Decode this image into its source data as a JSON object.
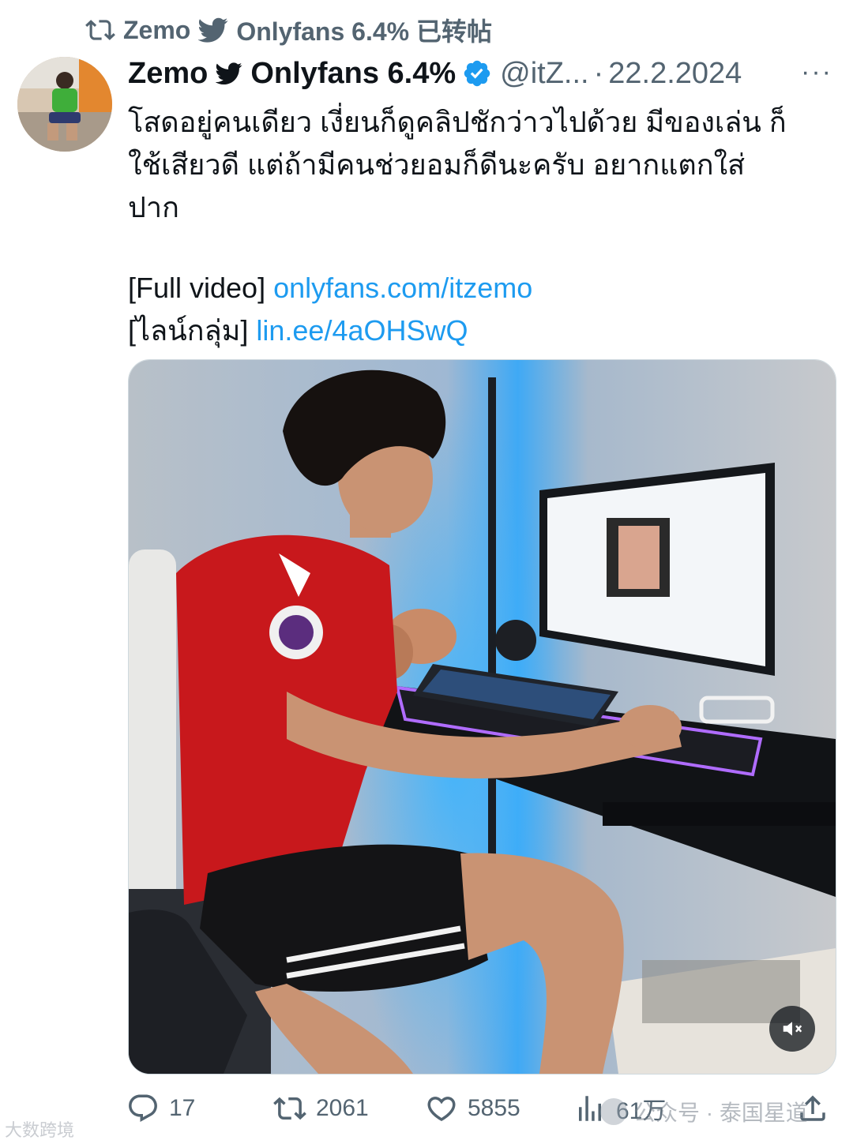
{
  "repost_banner": {
    "text": "Zemo",
    "suffix": "Onlyfans 6.4% 已转帖"
  },
  "author": {
    "name_a": "Zemo",
    "name_b": "Onlyfans 6.4%",
    "handle": "@itZ...",
    "date": "22.2.2024",
    "more": "···"
  },
  "tweet": {
    "line1": "โสดอยู่คนเดียว เงี่ยนก็ดูคลิปชักว่าวไปด้วย มีของเล่น ก็",
    "line2": "ใช้เสียวดี แต่ถ้ามีคนช่วยอมก็ดีนะครับ อยากแตกใส่",
    "line3": "ปาก",
    "full_video_label": "[Full video]",
    "full_video_link": "onlyfans.com/itzemo",
    "line_group_label": "[ไลน์กลุ่ม]",
    "line_group_link": "lin.ee/4aOHSwQ"
  },
  "actions": {
    "replies": "17",
    "reposts": "2061",
    "likes": "5855",
    "views": "61万"
  },
  "watermarks": {
    "left": "大数跨境",
    "right": "公众号 · 泰国星道"
  },
  "icons": [
    "repost-icon",
    "bird-icon",
    "verified-badge-icon",
    "reply-icon",
    "like-icon",
    "views-icon",
    "share-icon",
    "mute-icon"
  ],
  "colors": {
    "link": "#1d9bf0",
    "muted": "#536471",
    "verified": "#1d9bf0"
  }
}
